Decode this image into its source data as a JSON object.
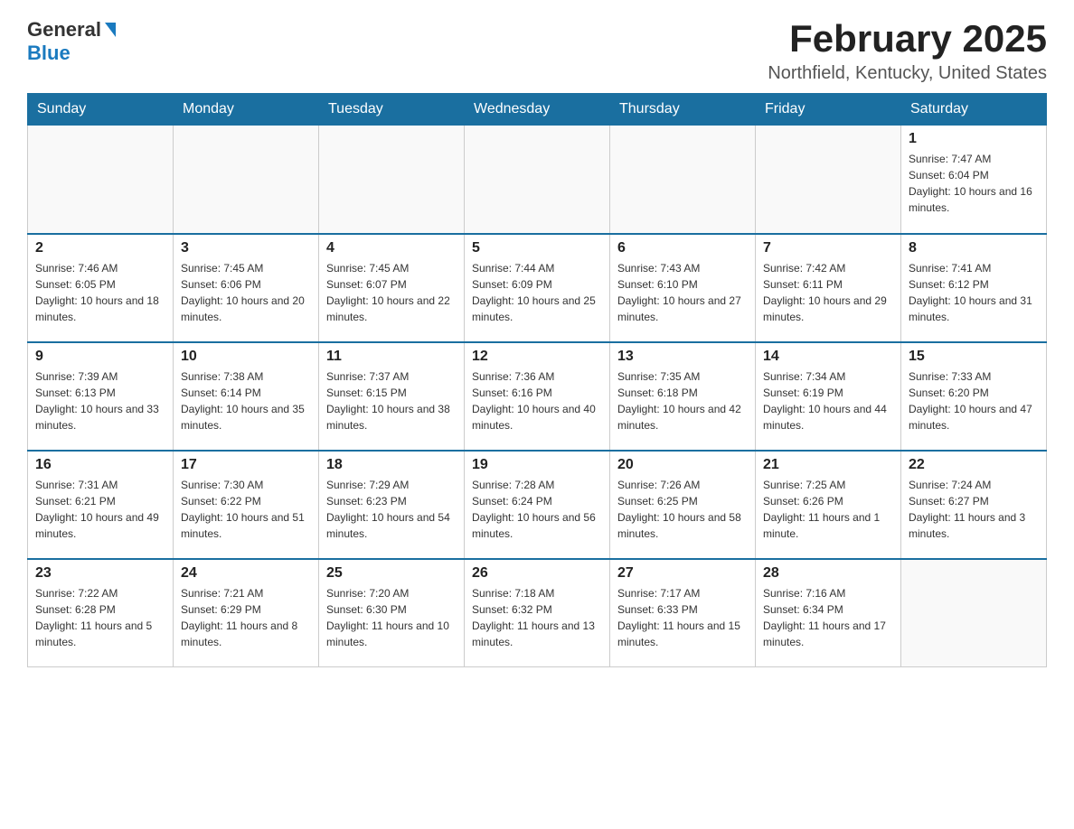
{
  "header": {
    "logo_general": "General",
    "logo_blue": "Blue",
    "title": "February 2025",
    "location": "Northfield, Kentucky, United States"
  },
  "days_of_week": [
    "Sunday",
    "Monday",
    "Tuesday",
    "Wednesday",
    "Thursday",
    "Friday",
    "Saturday"
  ],
  "weeks": [
    [
      {
        "day": "",
        "info": ""
      },
      {
        "day": "",
        "info": ""
      },
      {
        "day": "",
        "info": ""
      },
      {
        "day": "",
        "info": ""
      },
      {
        "day": "",
        "info": ""
      },
      {
        "day": "",
        "info": ""
      },
      {
        "day": "1",
        "info": "Sunrise: 7:47 AM\nSunset: 6:04 PM\nDaylight: 10 hours and 16 minutes."
      }
    ],
    [
      {
        "day": "2",
        "info": "Sunrise: 7:46 AM\nSunset: 6:05 PM\nDaylight: 10 hours and 18 minutes."
      },
      {
        "day": "3",
        "info": "Sunrise: 7:45 AM\nSunset: 6:06 PM\nDaylight: 10 hours and 20 minutes."
      },
      {
        "day": "4",
        "info": "Sunrise: 7:45 AM\nSunset: 6:07 PM\nDaylight: 10 hours and 22 minutes."
      },
      {
        "day": "5",
        "info": "Sunrise: 7:44 AM\nSunset: 6:09 PM\nDaylight: 10 hours and 25 minutes."
      },
      {
        "day": "6",
        "info": "Sunrise: 7:43 AM\nSunset: 6:10 PM\nDaylight: 10 hours and 27 minutes."
      },
      {
        "day": "7",
        "info": "Sunrise: 7:42 AM\nSunset: 6:11 PM\nDaylight: 10 hours and 29 minutes."
      },
      {
        "day": "8",
        "info": "Sunrise: 7:41 AM\nSunset: 6:12 PM\nDaylight: 10 hours and 31 minutes."
      }
    ],
    [
      {
        "day": "9",
        "info": "Sunrise: 7:39 AM\nSunset: 6:13 PM\nDaylight: 10 hours and 33 minutes."
      },
      {
        "day": "10",
        "info": "Sunrise: 7:38 AM\nSunset: 6:14 PM\nDaylight: 10 hours and 35 minutes."
      },
      {
        "day": "11",
        "info": "Sunrise: 7:37 AM\nSunset: 6:15 PM\nDaylight: 10 hours and 38 minutes."
      },
      {
        "day": "12",
        "info": "Sunrise: 7:36 AM\nSunset: 6:16 PM\nDaylight: 10 hours and 40 minutes."
      },
      {
        "day": "13",
        "info": "Sunrise: 7:35 AM\nSunset: 6:18 PM\nDaylight: 10 hours and 42 minutes."
      },
      {
        "day": "14",
        "info": "Sunrise: 7:34 AM\nSunset: 6:19 PM\nDaylight: 10 hours and 44 minutes."
      },
      {
        "day": "15",
        "info": "Sunrise: 7:33 AM\nSunset: 6:20 PM\nDaylight: 10 hours and 47 minutes."
      }
    ],
    [
      {
        "day": "16",
        "info": "Sunrise: 7:31 AM\nSunset: 6:21 PM\nDaylight: 10 hours and 49 minutes."
      },
      {
        "day": "17",
        "info": "Sunrise: 7:30 AM\nSunset: 6:22 PM\nDaylight: 10 hours and 51 minutes."
      },
      {
        "day": "18",
        "info": "Sunrise: 7:29 AM\nSunset: 6:23 PM\nDaylight: 10 hours and 54 minutes."
      },
      {
        "day": "19",
        "info": "Sunrise: 7:28 AM\nSunset: 6:24 PM\nDaylight: 10 hours and 56 minutes."
      },
      {
        "day": "20",
        "info": "Sunrise: 7:26 AM\nSunset: 6:25 PM\nDaylight: 10 hours and 58 minutes."
      },
      {
        "day": "21",
        "info": "Sunrise: 7:25 AM\nSunset: 6:26 PM\nDaylight: 11 hours and 1 minute."
      },
      {
        "day": "22",
        "info": "Sunrise: 7:24 AM\nSunset: 6:27 PM\nDaylight: 11 hours and 3 minutes."
      }
    ],
    [
      {
        "day": "23",
        "info": "Sunrise: 7:22 AM\nSunset: 6:28 PM\nDaylight: 11 hours and 5 minutes."
      },
      {
        "day": "24",
        "info": "Sunrise: 7:21 AM\nSunset: 6:29 PM\nDaylight: 11 hours and 8 minutes."
      },
      {
        "day": "25",
        "info": "Sunrise: 7:20 AM\nSunset: 6:30 PM\nDaylight: 11 hours and 10 minutes."
      },
      {
        "day": "26",
        "info": "Sunrise: 7:18 AM\nSunset: 6:32 PM\nDaylight: 11 hours and 13 minutes."
      },
      {
        "day": "27",
        "info": "Sunrise: 7:17 AM\nSunset: 6:33 PM\nDaylight: 11 hours and 15 minutes."
      },
      {
        "day": "28",
        "info": "Sunrise: 7:16 AM\nSunset: 6:34 PM\nDaylight: 11 hours and 17 minutes."
      },
      {
        "day": "",
        "info": ""
      }
    ]
  ]
}
